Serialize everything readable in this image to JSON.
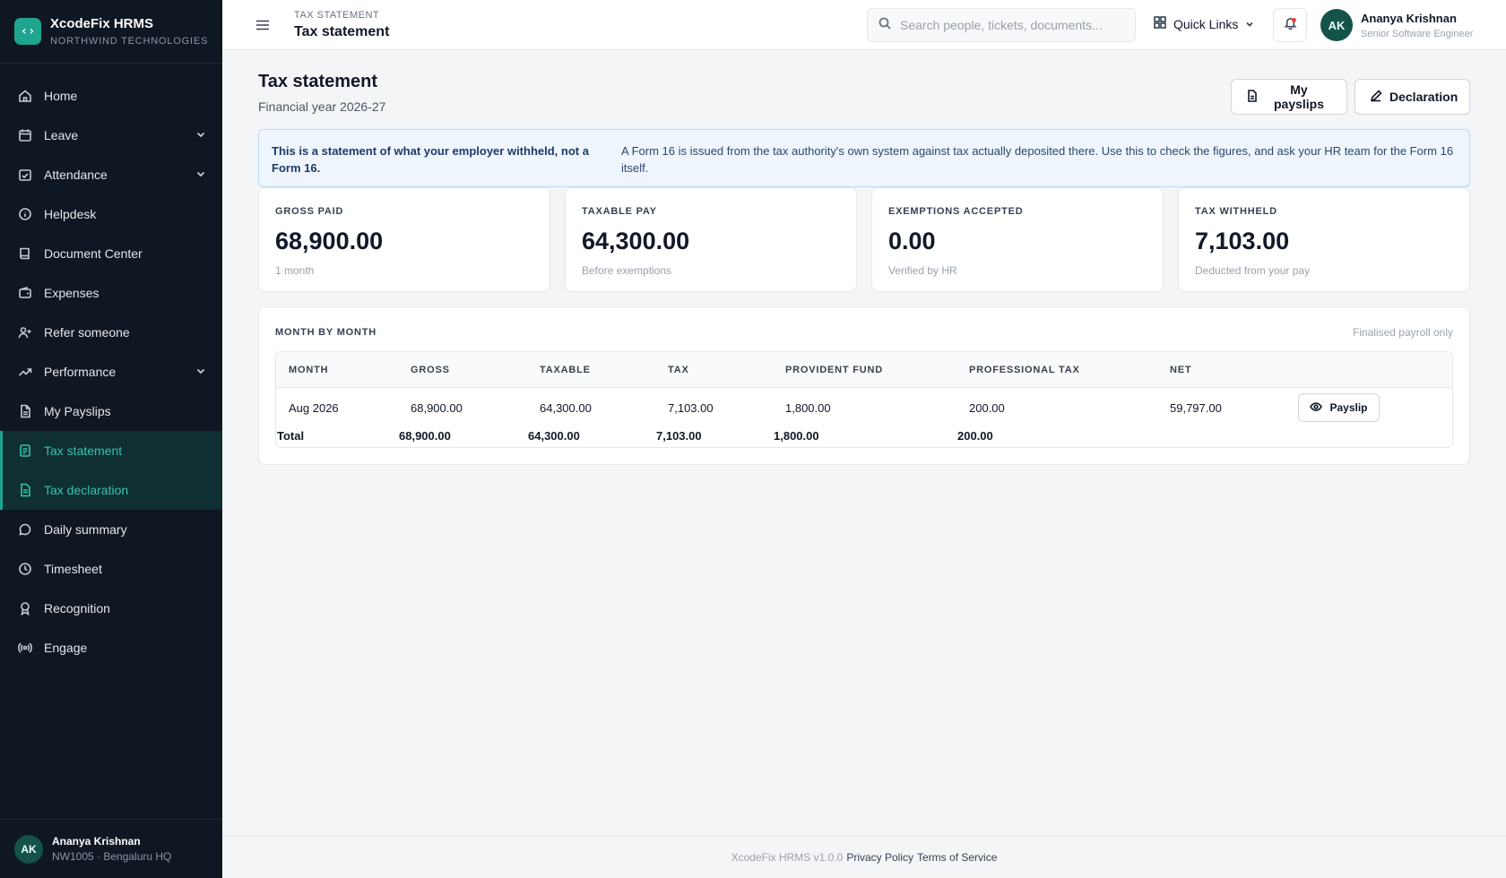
{
  "brand": {
    "title": "XcodeFix HRMS",
    "subtitle": "NORTHWIND TECHNOLOGIES",
    "logo_icon": "code-brackets-icon"
  },
  "sidebar": {
    "items": [
      {
        "label": "Home",
        "icon": "home-icon"
      },
      {
        "label": "Leave",
        "icon": "calendar-icon",
        "expandable": true
      },
      {
        "label": "Attendance",
        "icon": "calendar-check-icon",
        "expandable": true
      },
      {
        "label": "Helpdesk",
        "icon": "info-icon"
      },
      {
        "label": "Document Center",
        "icon": "book-icon"
      },
      {
        "label": "Expenses",
        "icon": "wallet-icon"
      },
      {
        "label": "Refer someone",
        "icon": "user-plus-icon"
      },
      {
        "label": "Performance",
        "icon": "trending-up-icon",
        "expandable": true
      },
      {
        "label": "My Payslips",
        "icon": "file-icon"
      },
      {
        "label": "Tax statement",
        "icon": "receipt-icon",
        "active": true
      },
      {
        "label": "Tax declaration",
        "icon": "file-text-icon",
        "active": true
      },
      {
        "label": "Daily summary",
        "icon": "chat-bubble-icon"
      },
      {
        "label": "Timesheet",
        "icon": "clock-icon"
      },
      {
        "label": "Recognition",
        "icon": "award-icon"
      },
      {
        "label": "Engage",
        "icon": "broadcast-icon"
      }
    ],
    "active_color": "#34c3ad",
    "footer": {
      "initials": "AK",
      "name": "Ananya Krishnan",
      "meta": "NW1005 · Bengaluru HQ"
    }
  },
  "header": {
    "crumb": "TAX STATEMENT",
    "title": "Tax statement",
    "search_placeholder": "Search people, tickets, documents...",
    "quick_links": "Quick Links",
    "user": {
      "initials": "AK",
      "name": "Ananya Krishnan",
      "role": "Senior Software Engineer"
    }
  },
  "page": {
    "title": "Tax statement",
    "subtitle": "Financial year 2026-27",
    "btn_payslips": "My payslips",
    "btn_declaration": "Declaration"
  },
  "notice": {
    "strong": "This is a statement of what your employer withheld, not a Form 16.",
    "text": "A Form 16 is issued from the tax authority's own system against tax actually deposited there. Use this to check the figures, and ask your HR team for the Form 16 itself."
  },
  "cards": [
    {
      "label": "GROSS PAID",
      "value": "68,900.00",
      "hint": "1 month"
    },
    {
      "label": "TAXABLE PAY",
      "value": "64,300.00",
      "hint": "Before exemptions"
    },
    {
      "label": "EXEMPTIONS ACCEPTED",
      "value": "0.00",
      "hint": "Verified by HR"
    },
    {
      "label": "TAX WITHHELD",
      "value": "7,103.00",
      "hint": "Deducted from your pay"
    }
  ],
  "table": {
    "title": "MONTH BY MONTH",
    "note": "Finalised payroll only",
    "headers": [
      "MONTH",
      "GROSS",
      "TAXABLE",
      "TAX",
      "PROVIDENT FUND",
      "PROFESSIONAL TAX",
      "NET"
    ],
    "rows": [
      {
        "month": "Aug 2026",
        "gross": "68,900.00",
        "taxable": "64,300.00",
        "tax": "7,103.00",
        "pf": "1,800.00",
        "pt": "200.00",
        "net": "59,797.00",
        "action": "Payslip"
      }
    ],
    "total": {
      "label": "Total",
      "gross": "68,900.00",
      "taxable": "64,300.00",
      "tax": "7,103.00",
      "pf": "1,800.00",
      "pt": "200.00"
    }
  },
  "footer": {
    "version": "XcodeFix HRMS v1.0.0",
    "privacy": "Privacy Policy",
    "terms": "Terms of Service"
  }
}
